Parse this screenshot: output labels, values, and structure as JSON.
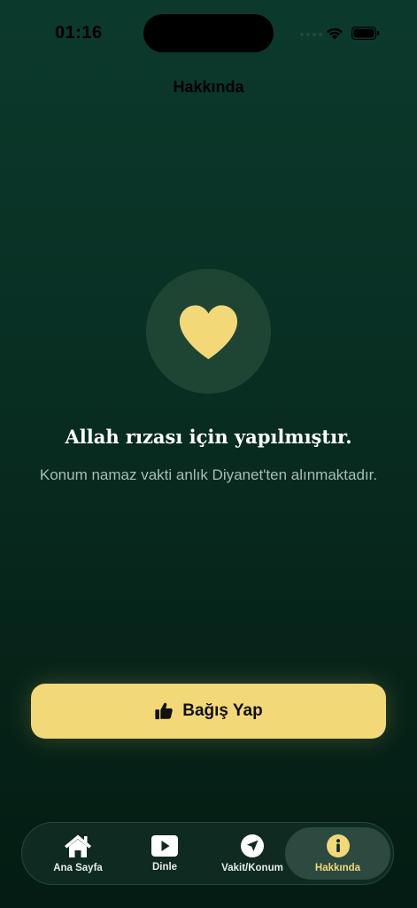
{
  "status_bar": {
    "time": "01:16"
  },
  "header": {
    "title": "Hakkında"
  },
  "main": {
    "icon": "heart-icon",
    "title": "Allah rızası için yapılmıştır.",
    "subtitle": "Konum namaz vakti anlık Diyanet'ten alınmaktadır."
  },
  "donate": {
    "icon": "thumbs-up-icon",
    "label": "Bağış Yap"
  },
  "tabs": [
    {
      "label": "Ana Sayfa",
      "icon": "home-icon",
      "active": false
    },
    {
      "label": "Dinle",
      "icon": "play-icon",
      "active": false
    },
    {
      "label": "Vakit/Konum",
      "icon": "location-arrow-icon",
      "active": false
    },
    {
      "label": "Hakkında",
      "icon": "info-icon",
      "active": true
    }
  ],
  "colors": {
    "accent": "#f2d877",
    "background_top": "#0b3a2c",
    "background_bottom": "#041c13",
    "heart_circle": "#1e4534",
    "subtitle_text": "#a9bcb4",
    "tab_bar": "#0f2a21",
    "tab_active": "#2c4a40"
  }
}
